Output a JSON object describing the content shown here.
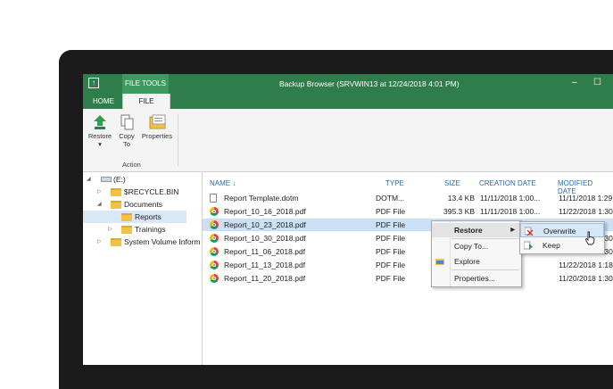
{
  "window": {
    "title": "Backup Browser (SRVWIN13 at 12/24/2018 4:01 PM)",
    "contextual_tab": "FILE TOOLS",
    "minimize": "–",
    "maximize": "☐"
  },
  "ribbon_tabs": [
    "HOME",
    "FILE"
  ],
  "ribbon": {
    "buttons": [
      {
        "label": "Restore",
        "sub": "▾"
      },
      {
        "label": "Copy",
        "sub": "To"
      },
      {
        "label": "Properties",
        "sub": ""
      }
    ],
    "group_label": "Action"
  },
  "tree": [
    {
      "label": "(E:)",
      "expanded": true
    },
    {
      "label": "$RECYCLE.BIN",
      "expanded": false
    },
    {
      "label": "Documents",
      "expanded": true
    },
    {
      "label": "Reports",
      "selected": true
    },
    {
      "label": "Trainings",
      "expanded": false
    },
    {
      "label": "System Volume Inform",
      "expanded": false
    }
  ],
  "list": {
    "columns": [
      "NAME",
      "TYPE",
      "SIZE",
      "CREATION DATE",
      "MODIFIED DATE"
    ],
    "sort_indicator": "↓",
    "rows": [
      {
        "name": "Report Template.dotm",
        "type": "DOTM...",
        "size": "13.4 KB",
        "created": "11/11/2018 1:00...",
        "modified": "11/11/2018 1:29",
        "icon": "doc"
      },
      {
        "name": "Report_10_16_2018.pdf",
        "type": "PDF  File",
        "size": "395.3 KB",
        "created": "11/11/2018 1:00...",
        "modified": "11/22/2018 1:30",
        "icon": "chrome"
      },
      {
        "name": "Report_10_23_2018.pdf",
        "type": "PDF  File",
        "size": "",
        "created": "",
        "modified": "",
        "icon": "chrome",
        "selected": true
      },
      {
        "name": "Report_10_30_2018.pdf",
        "type": "PDF  File",
        "size": "",
        "created": "",
        "modified": "11/22/2018 1:30",
        "icon": "chrome"
      },
      {
        "name": "Report_11_06_2018.pdf",
        "type": "PDF  File",
        "size": "",
        "created": "",
        "modified": "11/22/2018 1:30",
        "icon": "chrome"
      },
      {
        "name": "Report_11_13_2018.pdf",
        "type": "PDF  File",
        "size": "",
        "created": "",
        "modified": "11/22/2018 1:18",
        "icon": "chrome"
      },
      {
        "name": "Report_11_20_2018.pdf",
        "type": "PDF  File",
        "size": "",
        "created": "",
        "modified": "11/20/2018 1:30",
        "icon": "chrome"
      }
    ]
  },
  "context_menu": {
    "items": [
      {
        "label": "Restore",
        "has_submenu": true
      },
      {
        "label": "Copy To..."
      },
      {
        "label": "Explore"
      },
      {
        "label": "Properties..."
      }
    ]
  },
  "submenu": {
    "items": [
      {
        "label": "Overwrite"
      },
      {
        "label": "Keep"
      }
    ]
  },
  "colors": {
    "accent": "#2f7d4b",
    "contextual_tab": "#3f9a5f",
    "header_text": "#2b6cb0",
    "selection": "#cce0f5"
  }
}
